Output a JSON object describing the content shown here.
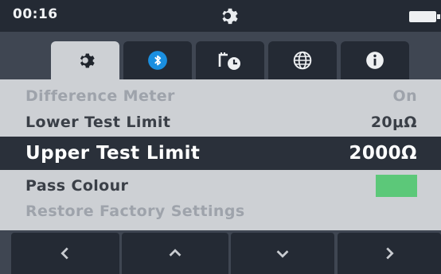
{
  "statusbar": {
    "time": "00:16",
    "center_icon": "gear-icon",
    "battery_icon": "battery-icon"
  },
  "tabs": [
    {
      "icon": "gear-icon",
      "active": true
    },
    {
      "icon": "bluetooth-icon",
      "active": false
    },
    {
      "icon": "timer-icon",
      "active": false
    },
    {
      "icon": "globe-icon",
      "active": false
    },
    {
      "icon": "info-icon",
      "active": false
    }
  ],
  "settings": {
    "difference_meter": {
      "label": "Difference Meter",
      "value": "On"
    },
    "lower_limit": {
      "label": "Lower Test Limit",
      "value": "20μΩ"
    },
    "upper_limit": {
      "label": "Upper Test Limit",
      "value": "2000Ω"
    },
    "pass_colour": {
      "label": "Pass Colour",
      "color": "#5cc879"
    },
    "restore": {
      "label": "Restore Factory Settings"
    }
  },
  "nav": [
    {
      "icon": "chevron-left-icon"
    },
    {
      "icon": "chevron-up-icon"
    },
    {
      "icon": "chevron-down-icon"
    },
    {
      "icon": "chevron-right-icon"
    }
  ],
  "colors": {
    "accent_bluetooth": "#1a8fe0",
    "pass_green": "#5cc879"
  }
}
